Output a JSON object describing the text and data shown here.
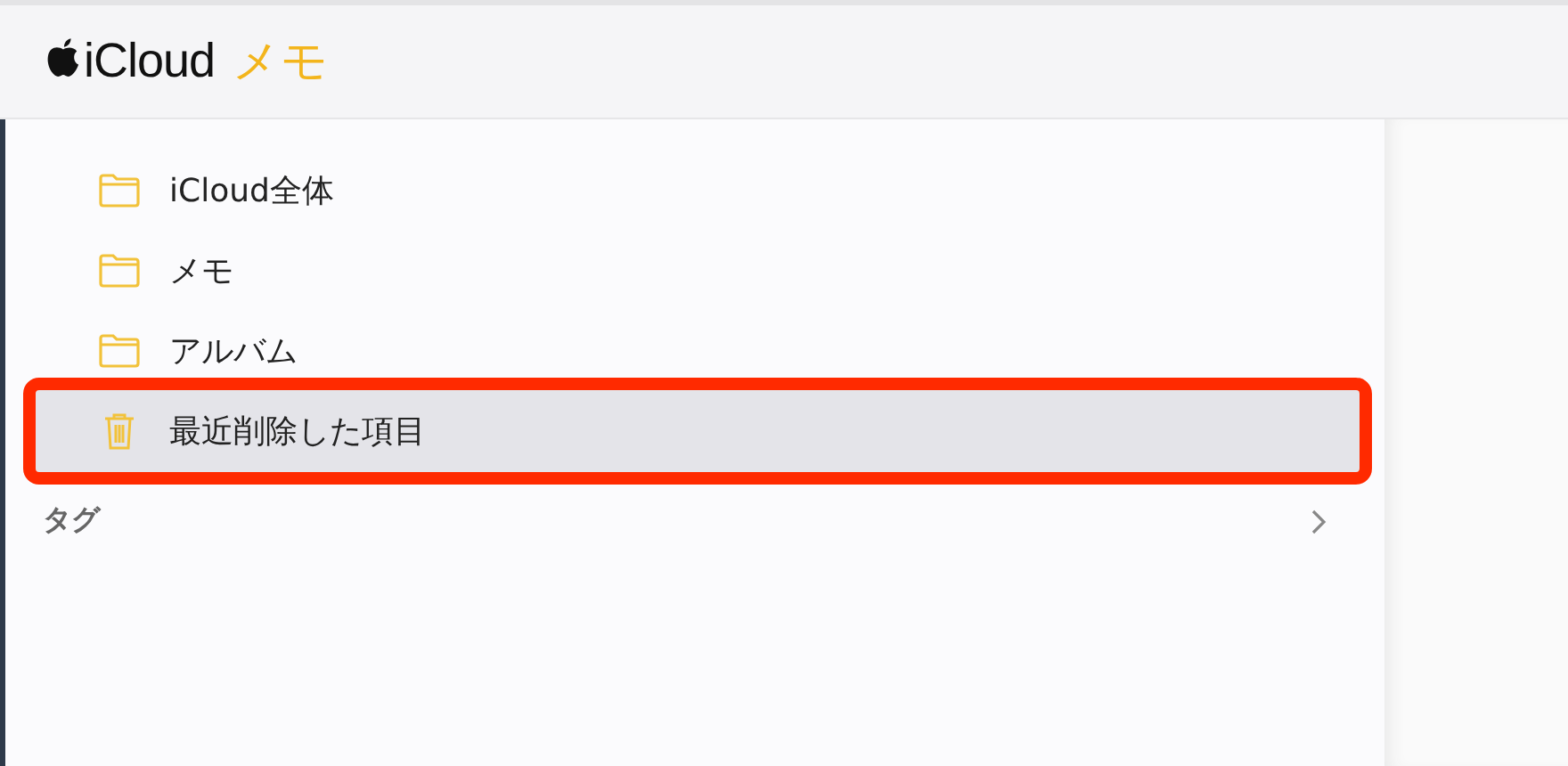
{
  "header": {
    "brand": "iCloud",
    "app": "メモ"
  },
  "folders": [
    {
      "label": "iCloud全体",
      "kind": "folder",
      "selected": false,
      "highlighted": false
    },
    {
      "label": "メモ",
      "kind": "folder",
      "selected": false,
      "highlighted": false
    },
    {
      "label": "アルバム",
      "kind": "folder",
      "selected": false,
      "highlighted": false
    },
    {
      "label": "最近削除した項目",
      "kind": "trash",
      "selected": true,
      "highlighted": true
    }
  ],
  "tags": {
    "label": "タグ",
    "expanded": false
  }
}
